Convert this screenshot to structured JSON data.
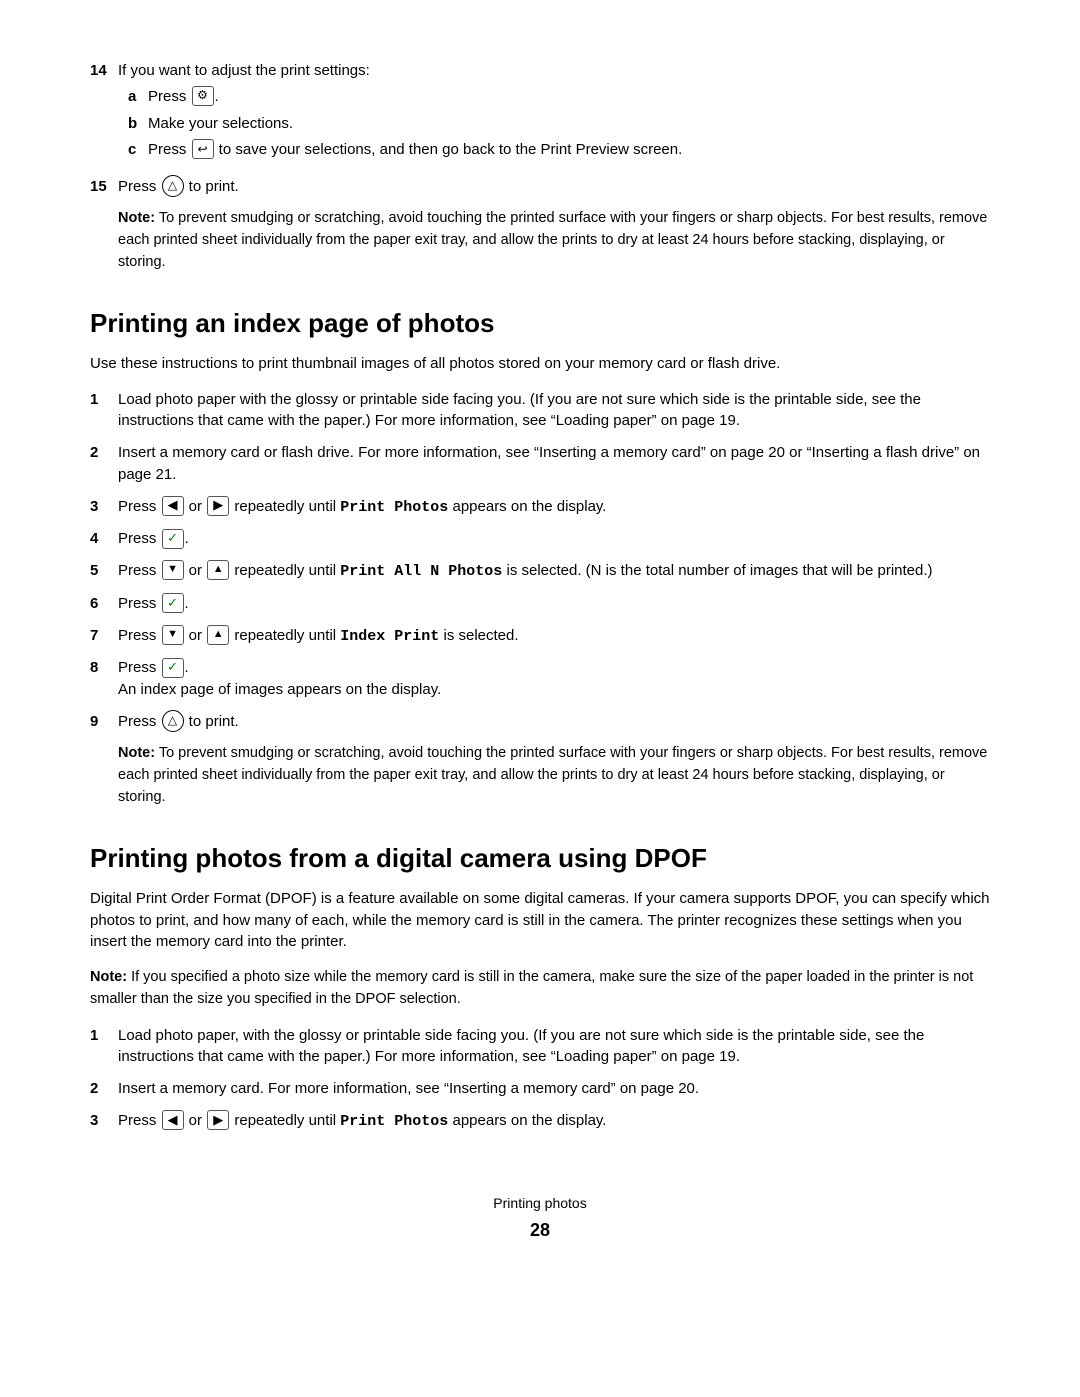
{
  "top_section": {
    "step14": {
      "num": "14",
      "text": "If you want to adjust the print settings:",
      "sub_steps": [
        {
          "label": "a",
          "text_before": "Press",
          "icon": "gear",
          "text_after": ""
        },
        {
          "label": "b",
          "text": "Make your selections."
        },
        {
          "label": "c",
          "text_before": "Press",
          "icon": "back",
          "text_after": "to save your selections, and then go back to the Print Preview screen."
        }
      ]
    },
    "step15": {
      "num": "15",
      "text_before": "Press",
      "icon": "print_circle",
      "text_after": "to print."
    },
    "note": {
      "label": "Note:",
      "text": "To prevent smudging or scratching, avoid touching the printed surface with your fingers or sharp objects. For best results, remove each printed sheet individually from the paper exit tray, and allow the prints to dry at least 24 hours before stacking, displaying, or storing."
    }
  },
  "section1": {
    "title": "Printing an index page of photos",
    "intro": "Use these instructions to print thumbnail images of all photos stored on your memory card or flash drive.",
    "steps": [
      {
        "num": "1",
        "text": "Load photo paper with the glossy or printable side facing you. (If you are not sure which side is the printable side, see the instructions that came with the paper.) For more information, see “Loading paper” on page 19."
      },
      {
        "num": "2",
        "text": "Insert a memory card or flash drive. For more information, see “Inserting a memory card” on page 20 or “Inserting a flash drive” on page 21."
      },
      {
        "num": "3",
        "text_before": "Press",
        "icon_left": "arrow_left",
        "text_middle": "or",
        "icon_right": "arrow_right",
        "text_after": "repeatedly until",
        "mono": "Print Photos",
        "text_end": "appears on the display."
      },
      {
        "num": "4",
        "text_before": "Press",
        "icon": "check",
        "text_after": "."
      },
      {
        "num": "5",
        "text_before": "Press",
        "icon_down": "arrow_down",
        "text_middle": "or",
        "icon_up": "arrow_up",
        "text_after": "repeatedly until",
        "mono": "Print All N Photos",
        "text_end": "is selected. (N is the total number of images that will be printed.)"
      },
      {
        "num": "6",
        "text_before": "Press",
        "icon": "check",
        "text_after": "."
      },
      {
        "num": "7",
        "text_before": "Press",
        "icon_down": "arrow_down",
        "text_middle": "or",
        "icon_up": "arrow_up",
        "text_after": "repeatedly until",
        "mono": "Index Print",
        "text_end": "is selected."
      },
      {
        "num": "8",
        "text_before": "Press",
        "icon": "check",
        "text_after": ".",
        "sub_note": "An index page of images appears on the display."
      },
      {
        "num": "9",
        "text_before": "Press",
        "icon": "print_circle",
        "text_after": "to print."
      }
    ],
    "note": {
      "label": "Note:",
      "text": "To prevent smudging or scratching, avoid touching the printed surface with your fingers or sharp objects. For best results, remove each printed sheet individually from the paper exit tray, and allow the prints to dry at least 24 hours before stacking, displaying, or storing."
    }
  },
  "section2": {
    "title": "Printing photos from a digital camera using DPOF",
    "intro1": "Digital Print Order Format (DPOF) is a feature available on some digital cameras. If your camera supports DPOF, you can specify which photos to print, and how many of each, while the memory card is still in the camera. The printer recognizes these settings when you insert the memory card into the printer.",
    "note": {
      "label": "Note:",
      "text": "If you specified a photo size while the memory card is still in the camera, make sure the size of the paper loaded in the printer is not smaller than the size you specified in the DPOF selection."
    },
    "steps": [
      {
        "num": "1",
        "text": "Load photo paper, with the glossy or printable side facing you. (If you are not sure which side is the printable side, see the instructions that came with the paper.) For more information, see “Loading paper” on page 19."
      },
      {
        "num": "2",
        "text": "Insert a memory card. For more information, see “Inserting a memory card” on page 20."
      },
      {
        "num": "3",
        "text_before": "Press",
        "icon_left": "arrow_left",
        "text_middle": "or",
        "icon_right": "arrow_right",
        "text_after": "repeatedly until",
        "mono": "Print Photos",
        "text_end": "appears on the display."
      }
    ]
  },
  "footer": {
    "text": "Printing photos",
    "page_num": "28"
  }
}
